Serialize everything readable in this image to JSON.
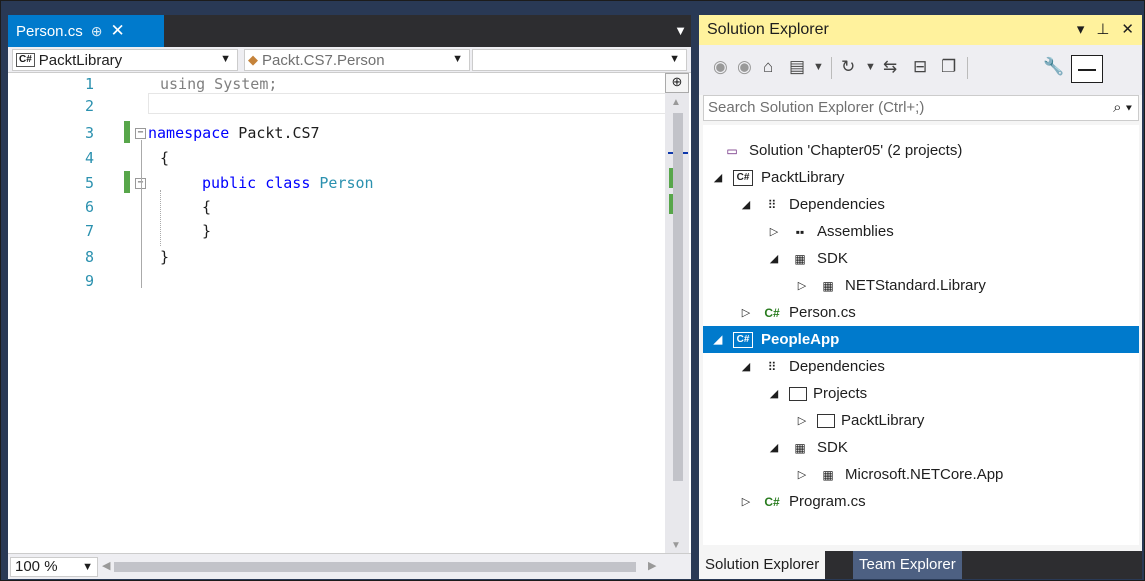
{
  "editor": {
    "tab_label": "Person.cs",
    "tab_pin": "⊕",
    "tab_close": "✕",
    "tabs_dropdown": "▼",
    "nav": {
      "project_badge": "C#",
      "project": "PacktLibrary",
      "type": "Packt.CS7.Person",
      "member": ""
    },
    "line_numbers": [
      "1",
      "2",
      "3",
      "4",
      "5",
      "6",
      "7",
      "8",
      "9"
    ],
    "lines": {
      "l1_kw": "using",
      "l1_rest": " System;",
      "l3_kw": "namespace",
      "l3_rest": " Packt.CS7",
      "l4": "{",
      "l5_kw": "public class",
      "l5_ty": "Person",
      "l6": "{",
      "l7": "}",
      "l8": "}"
    },
    "zoom": "100 %"
  },
  "solution_explorer": {
    "title": "Solution Explorer",
    "search_placeholder": "Search Solution Explorer (Ctrl+;)",
    "tree": [
      {
        "label": "Solution 'Chapter05' (2 projects)",
        "icon": "solution-icon"
      },
      {
        "label": "PacktLibrary",
        "icon": "csharp-project-icon"
      },
      {
        "label": "Dependencies",
        "icon": "dependencies-icon"
      },
      {
        "label": "Assemblies",
        "icon": "assemblies-icon"
      },
      {
        "label": "SDK",
        "icon": "sdk-icon"
      },
      {
        "label": "NETStandard.Library",
        "icon": "sdk-package-icon"
      },
      {
        "label": "Person.cs",
        "icon": "csharp-file-icon"
      },
      {
        "label": "PeopleApp",
        "icon": "csharp-project-icon"
      },
      {
        "label": "Dependencies",
        "icon": "dependencies-icon"
      },
      {
        "label": "Projects",
        "icon": "projects-icon"
      },
      {
        "label": "PacktLibrary",
        "icon": "project-reference-icon"
      },
      {
        "label": "SDK",
        "icon": "sdk-icon"
      },
      {
        "label": "Microsoft.NETCore.App",
        "icon": "sdk-package-icon"
      },
      {
        "label": "Program.cs",
        "icon": "csharp-file-icon"
      }
    ],
    "bottom_tabs": [
      "Solution Explorer",
      "Team Explorer"
    ]
  },
  "colors": {
    "accent": "#007acc",
    "se_title_bg": "#fff29d",
    "keyword": "#0000ff",
    "type": "#2b91af",
    "line_number": "#2b91af",
    "change_mark": "#57a64a"
  }
}
